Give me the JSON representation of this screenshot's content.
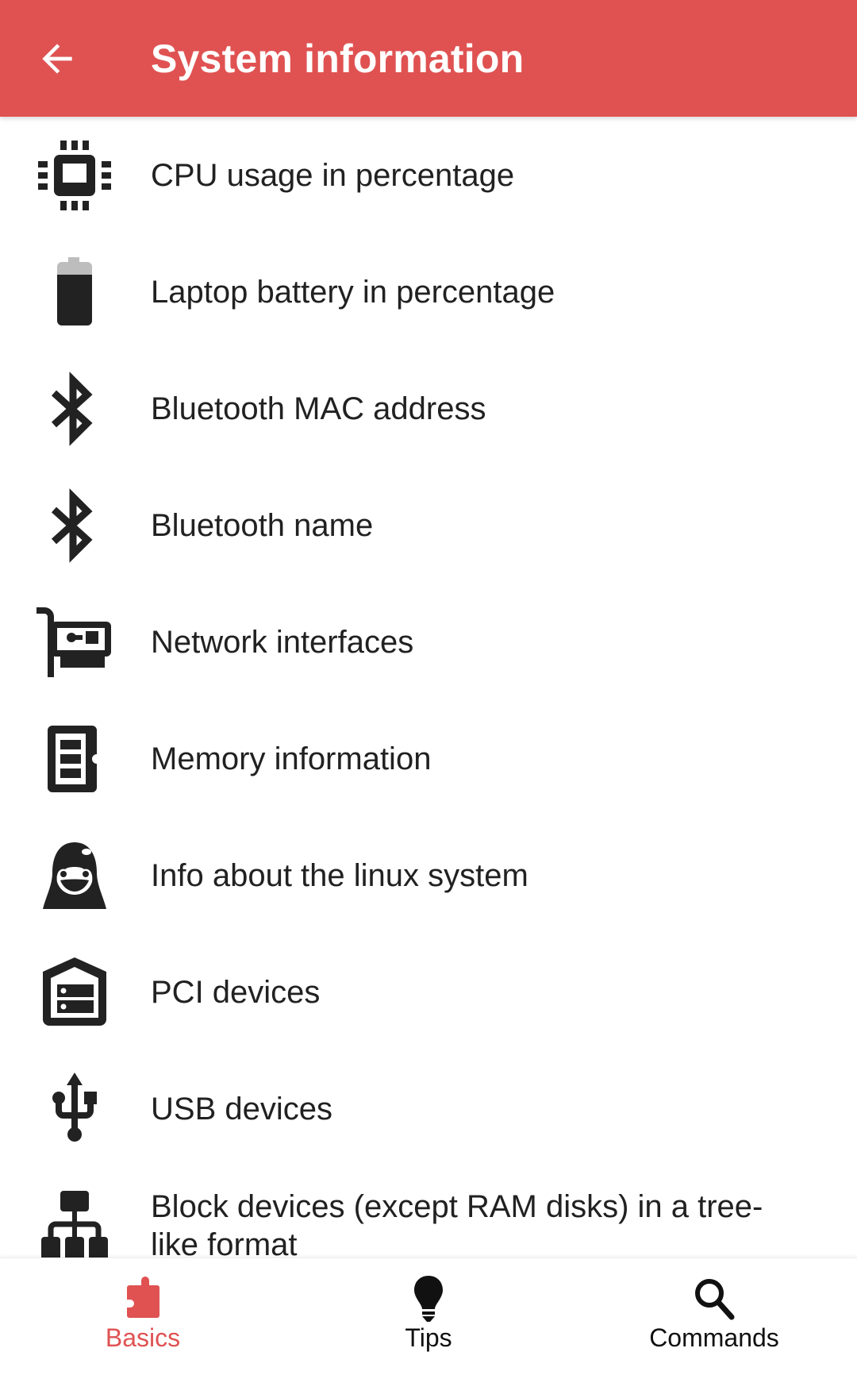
{
  "appbar": {
    "title": "System information",
    "back_icon": "arrow-left-icon",
    "background_color": "#E05252"
  },
  "items": [
    {
      "label": "CPU usage in percentage",
      "icon": "cpu-chip-icon"
    },
    {
      "label": "Laptop battery in percentage",
      "icon": "battery-icon"
    },
    {
      "label": "Bluetooth MAC address",
      "icon": "bluetooth-icon"
    },
    {
      "label": "Bluetooth name",
      "icon": "bluetooth-icon"
    },
    {
      "label": "Network interfaces",
      "icon": "network-card-icon"
    },
    {
      "label": "Memory information",
      "icon": "memory-card-icon"
    },
    {
      "label": "Info about the linux system",
      "icon": "linux-penguin-icon"
    },
    {
      "label": "PCI devices",
      "icon": "server-storage-icon"
    },
    {
      "label": "USB devices",
      "icon": "usb-icon"
    },
    {
      "label": "Block devices (except RAM disks) in a tree-like format",
      "icon": "sitemap-tree-icon"
    }
  ],
  "bottom_nav": {
    "active_color": "#E05252",
    "tabs": [
      {
        "label": "Basics",
        "icon": "puzzle-piece-icon",
        "active": true
      },
      {
        "label": "Tips",
        "icon": "lightbulb-icon",
        "active": false
      },
      {
        "label": "Commands",
        "icon": "search-icon",
        "active": false
      }
    ]
  }
}
